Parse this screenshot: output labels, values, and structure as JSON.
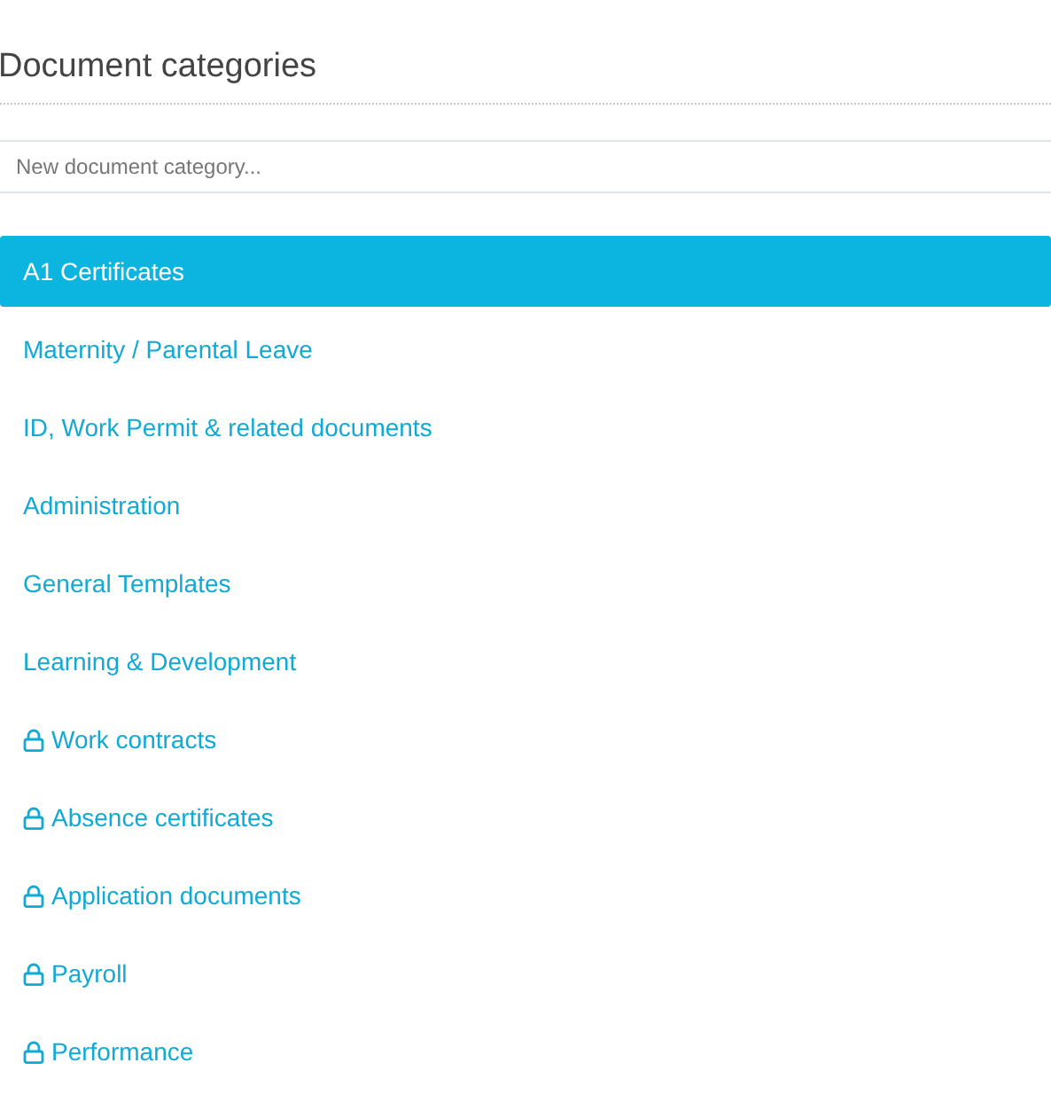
{
  "title": "Document categories",
  "new_category": {
    "placeholder": "New document category..."
  },
  "categories": [
    {
      "label": "A1 Certificates",
      "selected": true,
      "locked": false
    },
    {
      "label": "Maternity / Parental Leave",
      "selected": false,
      "locked": false
    },
    {
      "label": "ID, Work Permit & related documents",
      "selected": false,
      "locked": false
    },
    {
      "label": "Administration",
      "selected": false,
      "locked": false
    },
    {
      "label": "General Templates",
      "selected": false,
      "locked": false
    },
    {
      "label": "Learning & Development",
      "selected": false,
      "locked": false
    },
    {
      "label": "Work contracts",
      "selected": false,
      "locked": true
    },
    {
      "label": "Absence certificates",
      "selected": false,
      "locked": true
    },
    {
      "label": "Application documents",
      "selected": false,
      "locked": true
    },
    {
      "label": "Payroll",
      "selected": false,
      "locked": true
    },
    {
      "label": "Performance",
      "selected": false,
      "locked": true
    }
  ]
}
